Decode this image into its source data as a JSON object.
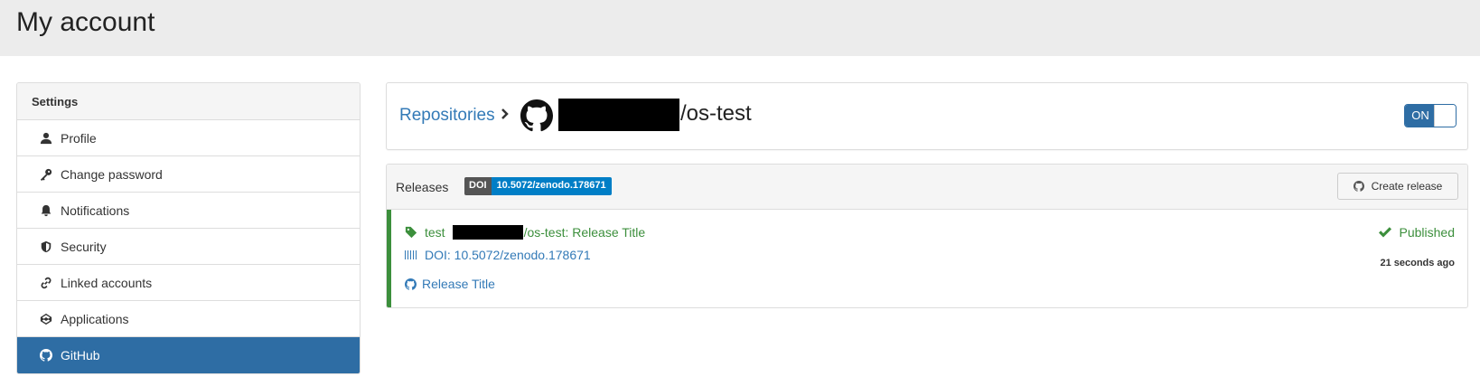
{
  "page": {
    "title": "My account"
  },
  "sidebar": {
    "heading": "Settings",
    "items": [
      {
        "label": "Profile",
        "icon": "user-icon"
      },
      {
        "label": "Change password",
        "icon": "key-icon"
      },
      {
        "label": "Notifications",
        "icon": "bell-icon"
      },
      {
        "label": "Security",
        "icon": "shield-icon"
      },
      {
        "label": "Linked accounts",
        "icon": "link-icon"
      },
      {
        "label": "Applications",
        "icon": "codepen-icon"
      },
      {
        "label": "GitHub",
        "icon": "github-icon",
        "active": true
      }
    ]
  },
  "repo": {
    "breadcrumb_link": "Repositories",
    "name_suffix": "/os-test",
    "toggle_label": "ON"
  },
  "releases": {
    "title": "Releases",
    "doi_badge": {
      "key": "DOI",
      "value": "10.5072/zenodo.178671"
    },
    "create_button": "Create release",
    "items": [
      {
        "tag_prefix": "test",
        "tag_suffix": "/os-test: Release Title",
        "doi_text": "DOI: 10.5072/zenodo.178671",
        "release_link": "Release Title",
        "status": "Published",
        "time_ago": "21 seconds ago"
      }
    ]
  },
  "colors": {
    "primary": "#2e6da4",
    "link": "#337ab7",
    "success": "#3c8f3c",
    "badge_key": "#555555",
    "badge_value": "#007ec6"
  }
}
